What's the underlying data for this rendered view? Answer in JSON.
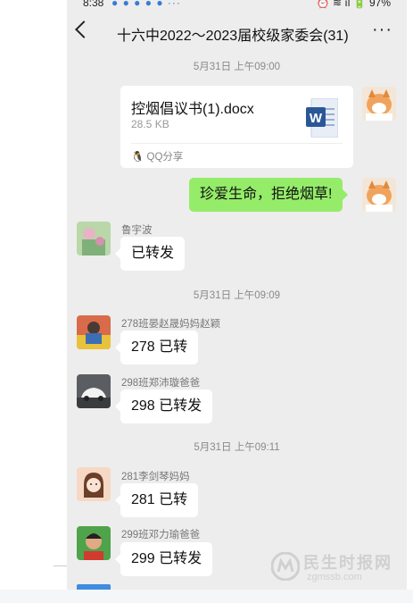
{
  "status_bar": {
    "time": "8:38",
    "notif_icons": "● ● ● ● ● ···",
    "right": "⏰ ≋ ıl 🔋 97%"
  },
  "header": {
    "title": "十六中2022～2023届校级家委会(31)",
    "more": "···"
  },
  "messages": {
    "ts1": "5月31日 上午09:00",
    "file": {
      "name": "控烟倡议书(1).docx",
      "size": "28.5 KB",
      "source": "QQ分享",
      "icon": "word-doc-icon"
    },
    "me_text": "珍爱生命，拒绝烟草!",
    "m1": {
      "sender": "鲁宇波",
      "text": "已转发"
    },
    "ts2": "5月31日 上午09:09",
    "m2": {
      "sender": "278班晏赵晟妈妈赵颖",
      "text": "278 已转"
    },
    "m3": {
      "sender": "298班郑沛璇爸爸",
      "text": "298 已转发"
    },
    "ts3": "5月31日 上午09:11",
    "m4": {
      "sender": "281李剑琴妈妈",
      "text": "281 已转"
    },
    "m5": {
      "sender": "299班邓力瑜爸爸",
      "text": "299 已转发"
    }
  },
  "watermark": {
    "title": "民生时报网",
    "url": "zgmssb.com"
  },
  "colors": {
    "bubble_self": "#95ec69",
    "chat_bg": "#ededed",
    "word_blue": "#2b5797"
  }
}
